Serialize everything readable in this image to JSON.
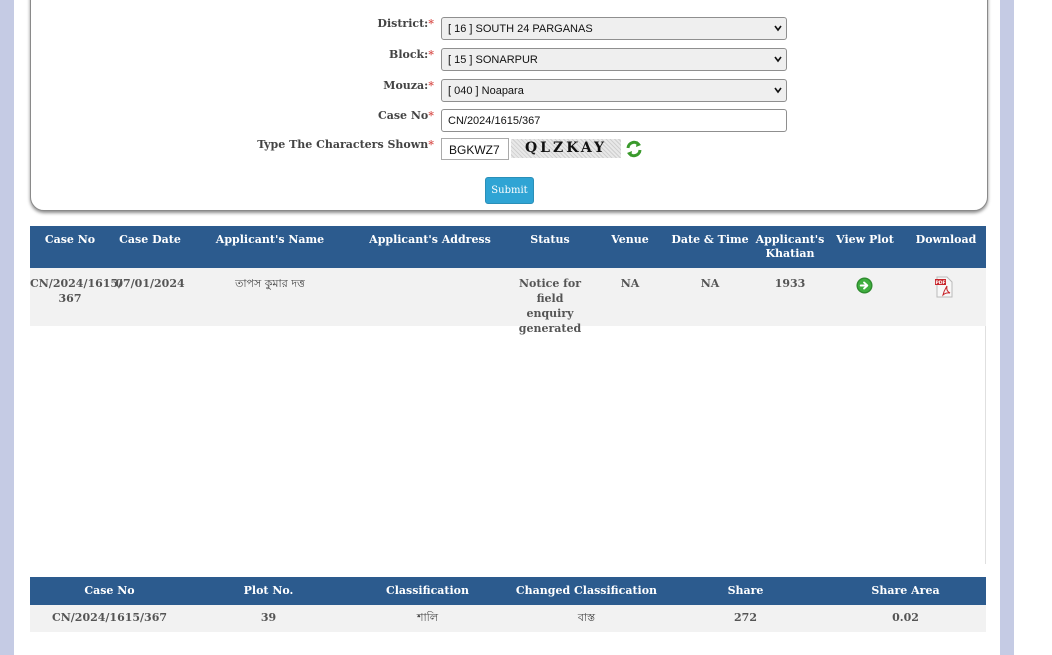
{
  "form": {
    "district": {
      "label": "District:",
      "req": "*",
      "value": "[ 16 ] SOUTH 24 PARGANAS"
    },
    "block": {
      "label": "Block:",
      "req": "*",
      "value": "[ 15 ] SONARPUR"
    },
    "mouza": {
      "label": "Mouza:",
      "req": "*",
      "value": "[ 040 ] Noapara"
    },
    "case_no": {
      "label": "Case No",
      "req": "*",
      "value": "CN/2024/1615/367"
    },
    "captcha": {
      "label": "Type The Characters Shown",
      "req": "*",
      "value": "BGKWZ7",
      "image_text": "QLZKAY"
    },
    "submit_label": "Submit"
  },
  "results": {
    "headers": {
      "case_no": "Case No",
      "case_date": "Case Date",
      "name": "Applicant's Name",
      "address": "Applicant's Address",
      "status": "Status",
      "venue": "Venue",
      "date_time": "Date & Time",
      "khatian_1": "Applicant's",
      "khatian_2": "Khatian",
      "view_plot": "View Plot",
      "download": "Download"
    },
    "row": {
      "case_no_1": "CN/2024/1615/",
      "case_no_2": "367",
      "case_date": "07/01/2024",
      "name": "তাপস কুমার দত্ত",
      "address": "",
      "status_1": "Notice for field",
      "status_2": "enquiry",
      "status_3": "generated",
      "venue": "NA",
      "date_time": "NA",
      "khatian": "1933",
      "download_icon_text": "PDF"
    }
  },
  "plots": {
    "headers": {
      "case_no": "Case No",
      "plot_no": "Plot No.",
      "classification": "Classification",
      "changed": "Changed Classification",
      "share": "Share",
      "share_area": "Share Area"
    },
    "row": {
      "case_no": "CN/2024/1615/367",
      "plot_no": "39",
      "classification": "শালি",
      "changed": "বাস্ত",
      "share": "272",
      "share_area": "0.02"
    }
  },
  "colors": {
    "header_bg": "#2c5b8e",
    "row_bg": "#f2f2f2",
    "submit_bg": "#2fa4d4",
    "required": "#d9534f",
    "rail": "#c5cbe4"
  },
  "icons": [
    "chevron-down-icon",
    "refresh-icon",
    "arrow-right-circle-icon",
    "pdf-icon"
  ]
}
